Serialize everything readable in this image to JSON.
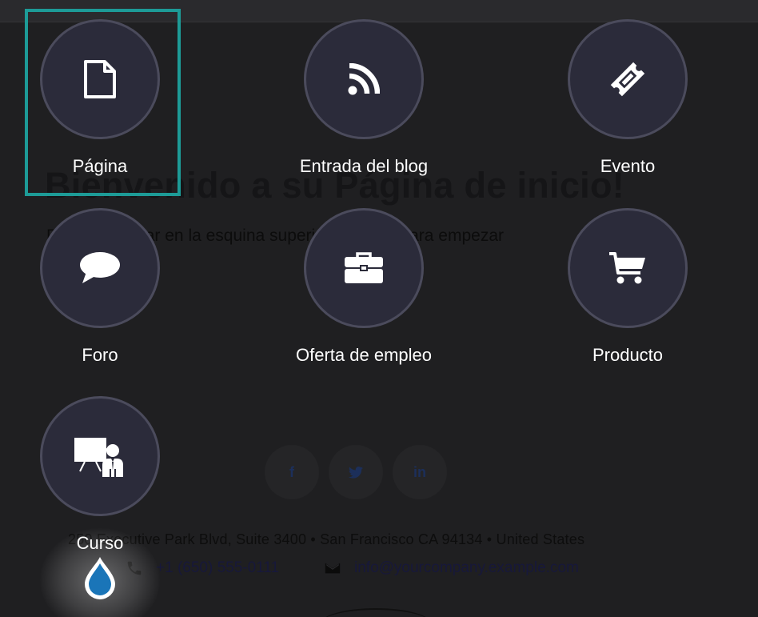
{
  "background": {
    "headline": "Bienvenido a su Página de inicio!",
    "subline": "Pulse en Editar en la esquina superior derecha para empezar",
    "social": {
      "facebook": "f",
      "twitter_icon": "twitter-icon",
      "linkedin": "in"
    },
    "address": "250 Executive Park Blvd, Suite 3400 • San Francisco CA 94134 • United States",
    "phone": "+1 (650) 555-0111",
    "email": "info@yourcompany.example.com"
  },
  "content_types": [
    {
      "label": "Página",
      "icon": "page-icon",
      "selected": true
    },
    {
      "label": "Entrada del blog",
      "icon": "rss-icon"
    },
    {
      "label": "Evento",
      "icon": "ticket-icon"
    },
    {
      "label": "Foro",
      "icon": "chat-bubble-icon"
    },
    {
      "label": "Oferta de empleo",
      "icon": "briefcase-icon"
    },
    {
      "label": "Producto",
      "icon": "cart-icon"
    },
    {
      "label": "Curso",
      "icon": "presentation-icon"
    }
  ],
  "colors": {
    "overlay_bg": "#1f1f21",
    "circle_bg": "#2b2b3a",
    "circle_border": "#4b4b5c",
    "focus_outline": "#1d9b97",
    "droplet": "#1a75b8",
    "label": "#ffffff"
  }
}
